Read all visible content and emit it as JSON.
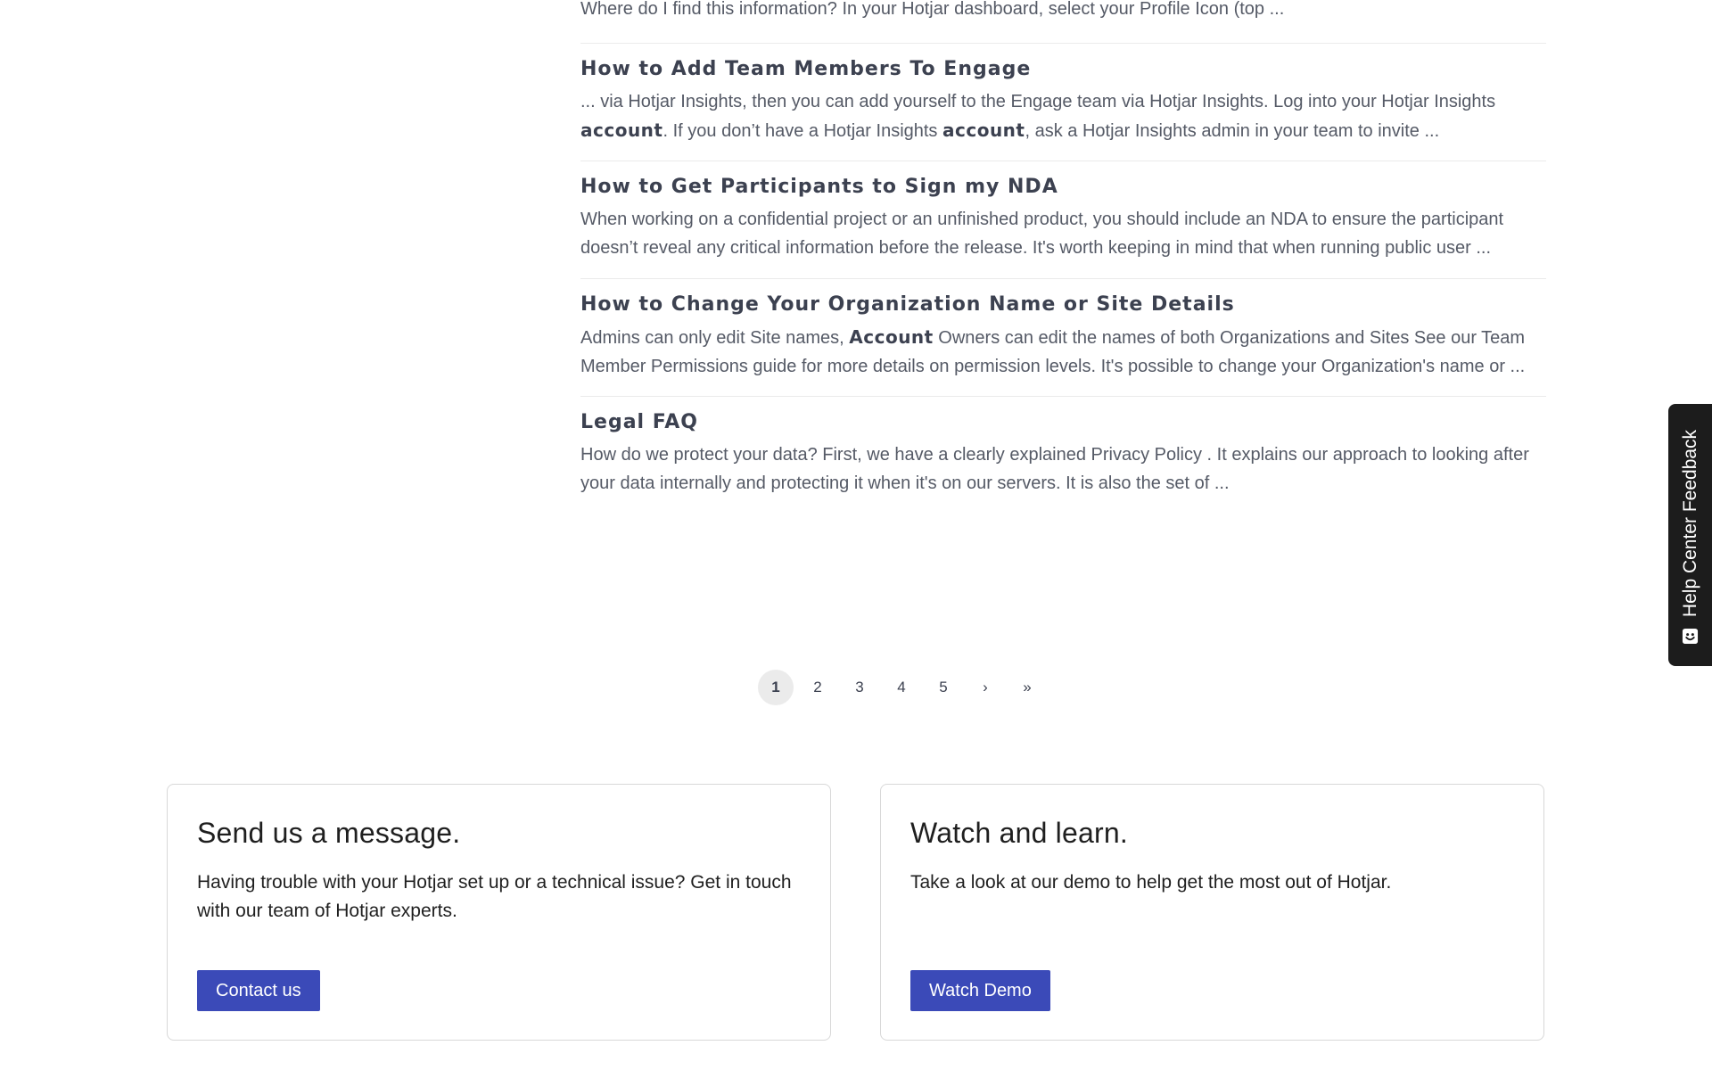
{
  "results": {
    "truncated_snippet": "Where do I find this information? In your Hotjar dashboard, select your Profile Icon (top ...",
    "items": [
      {
        "title": "How to Add Team Members To Engage",
        "snippet_parts": [
          "... via Hotjar Insights, then you can add yourself to the Engage team via Hotjar Insights. Log into your Hotjar Insights ",
          "account",
          ". If you don’t have a Hotjar Insights ",
          "account",
          ", ask a Hotjar Insights admin in your team to invite ..."
        ]
      },
      {
        "title": "How to Get Participants to Sign my NDA",
        "snippet_parts": [
          "When working on a confidential project or an unfinished product, you should include an NDA to ensure the participant doesn’t reveal any critical information before the release. It's worth keeping in mind that when running public user ..."
        ]
      },
      {
        "title": "How to Change Your Organization Name or Site Details",
        "snippet_parts": [
          "Admins can only edit Site names, ",
          "Account",
          " Owners can edit the names of both Organizations and Sites See our Team Member Permissions guide for more details on permission levels. It's possible to change your Organization's name or ..."
        ]
      },
      {
        "title": "Legal FAQ",
        "snippet_parts": [
          "How do we protect your data? First, we have a clearly explained Privacy Policy . It explains our approach to looking after your data internally and protecting it when it's on our servers. It is also the set of ..."
        ]
      }
    ]
  },
  "pagination": {
    "pages": [
      "1",
      "2",
      "3",
      "4",
      "5"
    ],
    "current": "1",
    "next": "›",
    "last": "»"
  },
  "cards": {
    "message": {
      "title": "Send us a message.",
      "text": "Having trouble with your Hotjar set up or a technical issue? Get in touch with our team of Hotjar experts.",
      "button": "Contact us"
    },
    "demo": {
      "title": "Watch and learn.",
      "text": "Take a look at our demo to help get the most out of Hotjar.",
      "button": "Watch Demo"
    }
  },
  "feedback_tab": {
    "label": "Help Center Feedback",
    "icon": "hotjar-smile-icon"
  },
  "colors": {
    "button": "#3b4ab8",
    "feedback_tab": "#1c1c1c",
    "title": "#3c4150",
    "body_text": "#555a66"
  }
}
